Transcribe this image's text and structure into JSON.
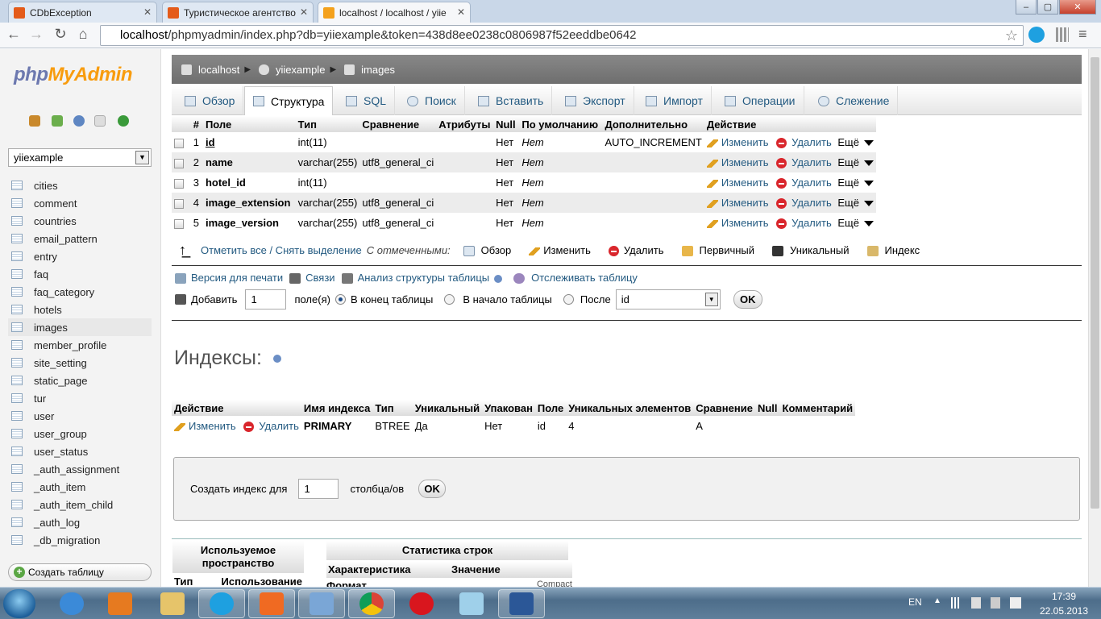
{
  "browser": {
    "tabs": [
      {
        "title": "CDbException",
        "icon_color": "#e45b1a"
      },
      {
        "title": "Туристическое агентство",
        "icon_color": "#e45b1a"
      },
      {
        "title": "localhost / localhost / yiie",
        "icon_color": "#f4a11c"
      }
    ],
    "url_host": "localhost",
    "url_rest": "/phpmyadmin/index.php?db=yiiexample&token=438d8ee0238c0806987f52eeddbe0642"
  },
  "sidebar": {
    "logo_php": "php",
    "logo_myadmin": "MyAdmin",
    "db_selected": "yiiexample",
    "tables": [
      "cities",
      "comment",
      "countries",
      "email_pattern",
      "entry",
      "faq",
      "faq_category",
      "hotels",
      "images",
      "member_profile",
      "site_setting",
      "static_page",
      "tur",
      "user",
      "user_group",
      "user_status",
      "_auth_assignment",
      "_auth_item",
      "_auth_item_child",
      "_auth_log",
      "_db_migration"
    ],
    "selected_table": "images",
    "create_table": "Создать таблицу"
  },
  "breadcrumb": {
    "server": "localhost",
    "db": "yiiexample",
    "table": "images"
  },
  "tabs": [
    "Обзор",
    "Структура",
    "SQL",
    "Поиск",
    "Вставить",
    "Экспорт",
    "Импорт",
    "Операции",
    "Слежение"
  ],
  "active_tab": "Структура",
  "structure": {
    "headers": [
      "#",
      "Поле",
      "Тип",
      "Сравнение",
      "Атрибуты",
      "Null",
      "По умолчанию",
      "Дополнительно",
      "Действие"
    ],
    "rows": [
      {
        "num": "1",
        "name": "id",
        "type": "int(11)",
        "collation": "",
        "attributes": "",
        "null": "Нет",
        "default": "Нет",
        "extra": "AUTO_INCREMENT"
      },
      {
        "num": "2",
        "name": "name",
        "type": "varchar(255)",
        "collation": "utf8_general_ci",
        "attributes": "",
        "null": "Нет",
        "default": "Нет",
        "extra": ""
      },
      {
        "num": "3",
        "name": "hotel_id",
        "type": "int(11)",
        "collation": "",
        "attributes": "",
        "null": "Нет",
        "default": "Нет",
        "extra": ""
      },
      {
        "num": "4",
        "name": "image_extension",
        "type": "varchar(255)",
        "collation": "utf8_general_ci",
        "attributes": "",
        "null": "Нет",
        "default": "Нет",
        "extra": ""
      },
      {
        "num": "5",
        "name": "image_version",
        "type": "varchar(255)",
        "collation": "utf8_general_ci",
        "attributes": "",
        "null": "Нет",
        "default": "Нет",
        "extra": ""
      }
    ],
    "action_edit": "Изменить",
    "action_delete": "Удалить",
    "action_more": "Ещё"
  },
  "bulk": {
    "check_all": "Отметить все / Снять выделение",
    "with_selected": "С отмеченными:",
    "actions": [
      "Обзор",
      "Изменить",
      "Удалить",
      "Первичный",
      "Уникальный",
      "Индекс"
    ]
  },
  "links": {
    "print": "Версия для печати",
    "relations": "Связи",
    "analyze": "Анализ структуры таблицы",
    "track": "Отслеживать таблицу"
  },
  "add_field": {
    "label": "Добавить",
    "count": "1",
    "fields_label": "поле(я)",
    "at_end": "В конец таблицы",
    "at_start": "В начало таблицы",
    "after": "После",
    "after_field": "id",
    "ok": "OK"
  },
  "indexes": {
    "title": "Индексы:",
    "headers": [
      "Действие",
      "Имя индекса",
      "Тип",
      "Уникальный",
      "Упакован",
      "Поле",
      "Уникальных элементов",
      "Сравнение",
      "Null",
      "Комментарий"
    ],
    "row": {
      "edit": "Изменить",
      "delete": "Удалить",
      "name": "PRIMARY",
      "type": "BTREE",
      "unique": "Да",
      "packed": "Нет",
      "field": "id",
      "cardinality": "4",
      "collation": "A",
      "null": "",
      "comment": ""
    },
    "create_label": "Создать индекс для",
    "create_count": "1",
    "columns_label": "столбца/ов",
    "ok": "OK"
  },
  "stats": {
    "space_title": "Используемое пространство",
    "space_headers": [
      "Тип",
      "Использование"
    ],
    "rows_title": "Статистика строк",
    "rows_headers": [
      "Характеристика",
      "Значение"
    ],
    "first_row": "Формат",
    "first_value": "Compact"
  },
  "taskbar": {
    "lang": "EN",
    "time": "17:39",
    "date": "22.05.2013"
  }
}
